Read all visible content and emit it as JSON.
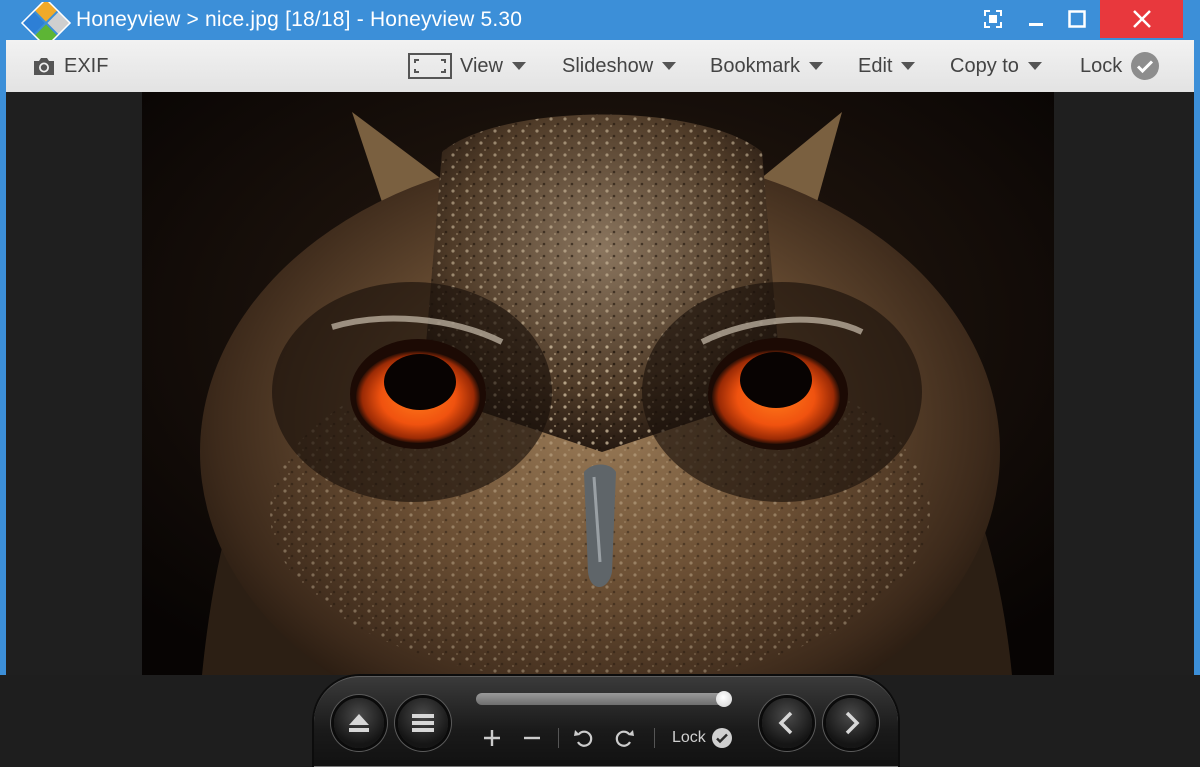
{
  "window": {
    "title": "Honeyview > nice.jpg [18/18] - Honeyview 5.30",
    "accent_color": "#3c8fd8",
    "close_color": "#e8383d",
    "controls": [
      {
        "name": "fullscreen-icon"
      },
      {
        "name": "minimize-icon"
      },
      {
        "name": "maximize-icon"
      },
      {
        "name": "close-icon"
      }
    ]
  },
  "toolbar": {
    "exif_label": "EXIF",
    "view_label": "View",
    "slideshow_label": "Slideshow",
    "bookmark_label": "Bookmark",
    "edit_label": "Edit",
    "copy_to_label": "Copy to",
    "lock_label": "Lock"
  },
  "image": {
    "file_name": "nice.jpg",
    "index": 18,
    "total": 18,
    "subject": "owl close-up"
  },
  "panel": {
    "progress_fraction": 1.0,
    "lock_label": "Lock",
    "icons": [
      "eject-icon",
      "menu-icon",
      "zoom-in-icon",
      "zoom-out-icon",
      "rotate-left-icon",
      "rotate-right-icon",
      "check-icon",
      "prev-icon",
      "next-icon"
    ]
  }
}
